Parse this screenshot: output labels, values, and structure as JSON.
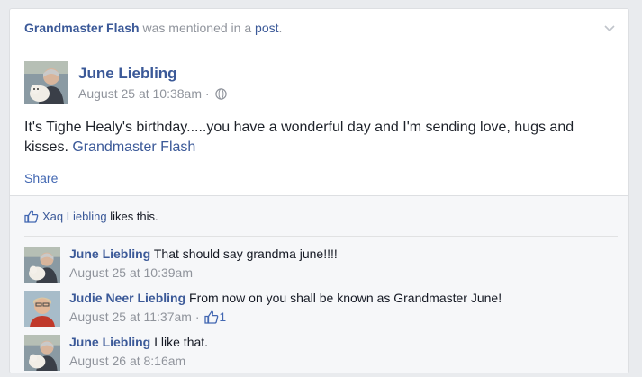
{
  "header": {
    "subject": "Grandmaster Flash",
    "mid_text": "was mentioned in a",
    "post_link": "post",
    "period": ".",
    "menu_icon": "chevron-down-icon"
  },
  "post": {
    "author": "June Liebling",
    "timestamp": "August 25 at 10:38am",
    "separator": "·",
    "audience_icon": "globe-icon",
    "text": "It's Tighe Healy's birthday.....you have a wonderful day and I'm sending love, hugs and kisses.",
    "mention": "Grandmaster Flash",
    "share_label": "Share"
  },
  "likes": {
    "icon": "thumbs-up-icon",
    "liker": "Xaq Liebling",
    "suffix": "likes this."
  },
  "comments": [
    {
      "author": "June Liebling",
      "text": "That should say grandma june!!!!",
      "time": "August 25 at 10:39am"
    },
    {
      "author": "Judie Neer Liebling",
      "text": "From now on you shall be known as Grandmaster June!",
      "time": "August 25 at 11:37am",
      "separator": "·",
      "like_count": "1"
    },
    {
      "author": "June Liebling",
      "text": "I like that.",
      "time": "August 26 at 8:16am"
    }
  ],
  "colors": {
    "link": "#3b5998",
    "muted": "#90949c",
    "background": "#e9ebee",
    "ufi_background": "#f6f7f9"
  }
}
